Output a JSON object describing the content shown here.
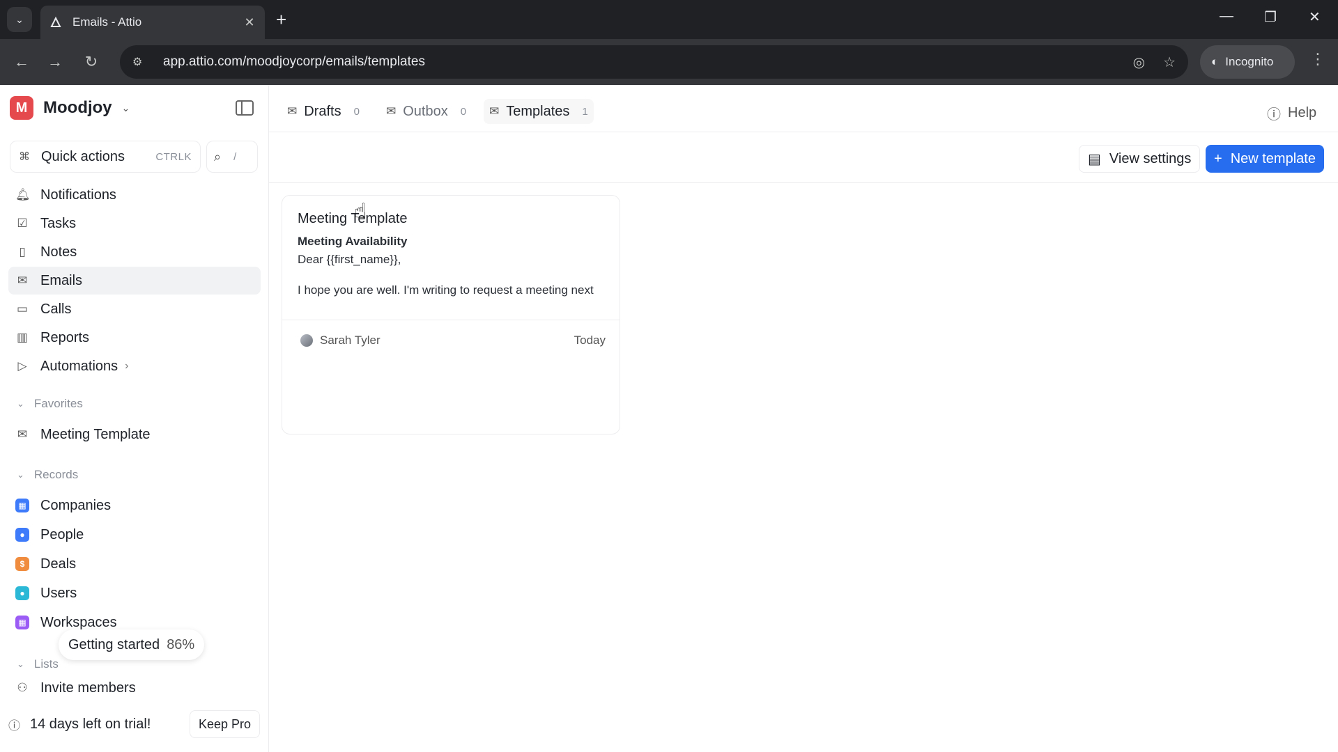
{
  "browser": {
    "tab_title": "Emails - Attio",
    "url": "app.attio.com/moodjoycorp/emails/templates",
    "incognito_label": "Incognito"
  },
  "workspace": {
    "initial": "M",
    "name": "Moodjoy"
  },
  "sidebar": {
    "quick_actions_label": "Quick actions",
    "quick_actions_shortcut": "CTRLK",
    "search_shortcut": "/",
    "items": [
      {
        "label": "Notifications"
      },
      {
        "label": "Tasks"
      },
      {
        "label": "Notes"
      },
      {
        "label": "Emails"
      },
      {
        "label": "Calls"
      },
      {
        "label": "Reports"
      },
      {
        "label": "Automations"
      }
    ],
    "favorites_label": "Favorites",
    "favorites": [
      {
        "label": "Meeting Template"
      }
    ],
    "records_label": "Records",
    "records": [
      {
        "label": "Companies",
        "color": "#3e7bfa"
      },
      {
        "label": "People",
        "color": "#3e7bfa"
      },
      {
        "label": "Deals",
        "color": "#f08c3d"
      },
      {
        "label": "Users",
        "color": "#2ab8d6"
      },
      {
        "label": "Workspaces",
        "color": "#9b5cf5"
      }
    ],
    "lists_label": "Lists",
    "getting_started_label": "Getting started",
    "getting_started_pct": "86%",
    "invite_label": "Invite members",
    "trial_label": "14 days left on trial!",
    "keep_pro_label": "Keep Pro"
  },
  "main": {
    "tabs": [
      {
        "label": "Drafts",
        "count": "0"
      },
      {
        "label": "Outbox",
        "count": "0"
      },
      {
        "label": "Templates",
        "count": "1"
      }
    ],
    "help_label": "Help",
    "view_settings_label": "View settings",
    "new_template_label": "New template",
    "accent": "#266df0",
    "card": {
      "title": "Meeting Template",
      "subject": "Meeting Availability",
      "line1": "Dear {{first_name}},",
      "line2": "I hope you are well. I'm writing to request a meeting next",
      "author": "Sarah Tyler",
      "date": "Today"
    }
  }
}
